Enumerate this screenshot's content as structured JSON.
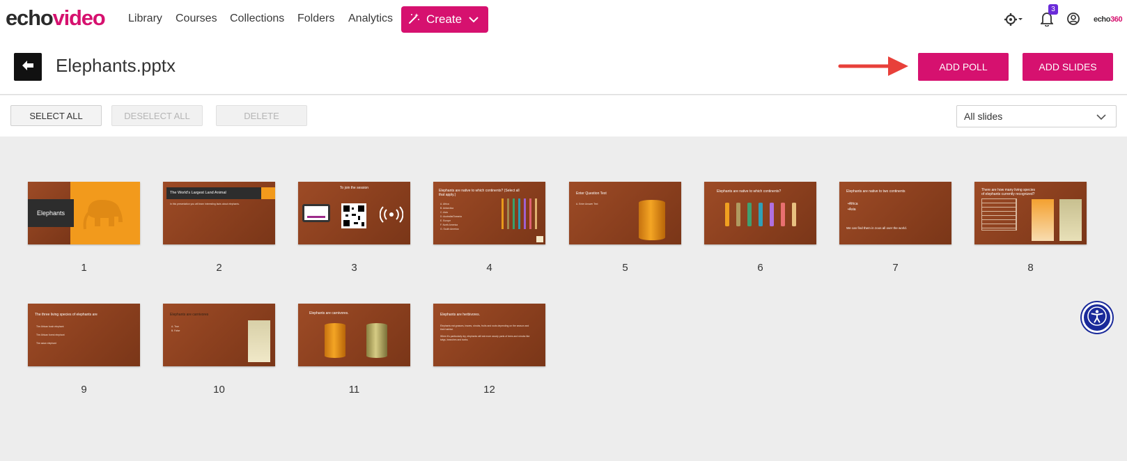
{
  "app": {
    "logo_part1": "echo",
    "logo_part2": "video",
    "brand_small_part1": "echo",
    "brand_small_part2": "360",
    "notification_count": "3"
  },
  "nav": {
    "items": [
      {
        "label": "Library"
      },
      {
        "label": "Courses"
      },
      {
        "label": "Collections"
      },
      {
        "label": "Folders"
      },
      {
        "label": "Analytics"
      }
    ],
    "create_label": "Create"
  },
  "header": {
    "title": "Elephants.pptx",
    "add_poll_label": "ADD POLL",
    "add_slides_label": "ADD SLIDES"
  },
  "toolbar": {
    "select_all": "SELECT ALL",
    "deselect_all": "DESELECT ALL",
    "delete": "DELETE",
    "filter_value": "All slides"
  },
  "slides": [
    {
      "number": "1",
      "title": "Elephants"
    },
    {
      "number": "2",
      "title": "The World's Largest Land Animal",
      "body": "In this presentation you will learn interesting facts about elephants."
    },
    {
      "number": "3",
      "title": "To join the session"
    },
    {
      "number": "4",
      "title": "Elephants are native to which continents? (Select all that apply.)",
      "options": [
        "A. Africa",
        "B. Antarctica",
        "C. Asia",
        "D. Australia/Oceania",
        "E. Europe",
        "F. North America",
        "G. South America"
      ]
    },
    {
      "number": "5",
      "title": "Enter Question Text",
      "body": "A. Enter Answer Text"
    },
    {
      "number": "6",
      "title": "Elephants are native to which continents?"
    },
    {
      "number": "7",
      "title": "Elephants are native to two continents",
      "bullets": [
        "•Africa",
        "•Asia"
      ],
      "body": "We can find them in zoos all over the world."
    },
    {
      "number": "8",
      "title": "There are how many living species of elephants currently recognized?"
    },
    {
      "number": "9",
      "title": "The three living species of elephants are",
      "bullets": [
        "The African bush elephant",
        "The African forest elephant",
        "The asian elephant"
      ]
    },
    {
      "number": "10",
      "title": "Elephants are carnivores",
      "options": [
        "A. True",
        "B. False"
      ]
    },
    {
      "number": "11",
      "title": "Elephants are carnivores."
    },
    {
      "number": "12",
      "title": "Elephants are herbivores.",
      "body": "Elephants eat grasses, leaves, shrubs, fruits and roots depending on the season and their habitat.",
      "body2": "When it's particularly dry, elephants will eat more woody parts of trees and shrubs like twigs, branches and barks."
    }
  ],
  "colors": {
    "accent": "#d6116f",
    "slide_bg": "#8f421f",
    "page_bg": "#ededed"
  }
}
